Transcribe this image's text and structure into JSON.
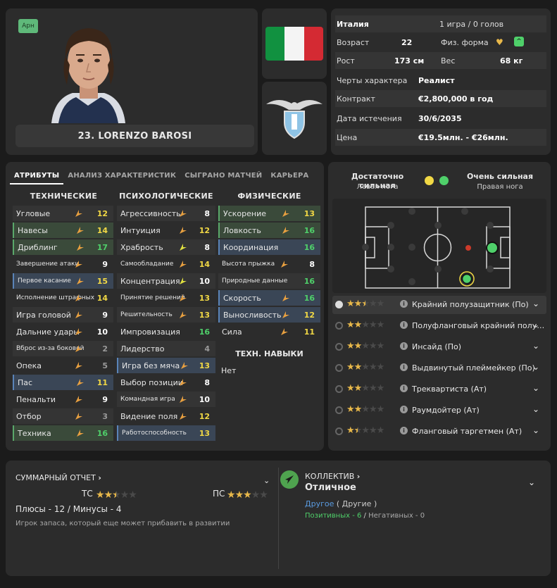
{
  "player": {
    "badge": "Арн",
    "name": "23. LORENZO BAROSI"
  },
  "info": {
    "nation": "Италия",
    "caps": "1 игра / 0 голов",
    "age_label": "Возраст",
    "age": "22",
    "fitness_label": "Физ. форма",
    "height_label": "Рост",
    "height": "173 см",
    "weight_label": "Вес",
    "weight": "68 кг",
    "traits_label": "Черты характера",
    "traits": "Реалист",
    "contract_label": "Контракт",
    "contract": "€2,800,000 в год",
    "expiry_label": "Дата истечения",
    "expiry": "30/6/2035",
    "price_label": "Цена",
    "price": "€19.5млн. - €26млн."
  },
  "tabs": [
    "АТРИБУТЫ",
    "АНАЛИЗ ХАРАКТЕРИСТИК",
    "СЫГРАНО МАТЧЕЙ",
    "КАРЬЕРА"
  ],
  "columns": {
    "technical": "ТЕХНИЧЕСКИЕ",
    "mental": "ПСИХОЛОГИЧЕСКИЕ",
    "physical": "ФИЗИЧЕСКИЕ",
    "skills": "ТЕХН. НАВЫКИ",
    "skills_value": "Нет"
  },
  "technical": [
    {
      "name": "Угловые",
      "value": "12",
      "hl": "dark",
      "color": "yellow",
      "arrow": "orange"
    },
    {
      "name": "Навесы",
      "value": "14",
      "hl": "green",
      "color": "yellow",
      "arrow": "orange"
    },
    {
      "name": "Дриблинг",
      "value": "17",
      "hl": "green",
      "color": "green",
      "arrow": "orange"
    },
    {
      "name": "Завершение атаки",
      "value": "9",
      "hl": "none",
      "color": "white",
      "arrow": "orange",
      "small": true
    },
    {
      "name": "Первое касание",
      "value": "15",
      "hl": "blue",
      "color": "yellow",
      "arrow": "orange",
      "small": true
    },
    {
      "name": "Исполнение штрафных",
      "value": "14",
      "hl": "none",
      "color": "yellow",
      "arrow": "orange",
      "small": true
    },
    {
      "name": "Игра головой",
      "value": "9",
      "hl": "dark",
      "color": "white",
      "arrow": "orange"
    },
    {
      "name": "Дальние удары",
      "value": "10",
      "hl": "none",
      "color": "white",
      "arrow": "orange"
    },
    {
      "name": "Вброс из-за боковой",
      "value": "2",
      "hl": "dark",
      "color": "grey",
      "arrow": "orange",
      "small": true
    },
    {
      "name": "Опека",
      "value": "5",
      "hl": "none",
      "color": "grey",
      "arrow": "orange"
    },
    {
      "name": "Пас",
      "value": "11",
      "hl": "blue",
      "color": "yellow",
      "arrow": "orange"
    },
    {
      "name": "Пенальти",
      "value": "9",
      "hl": "none",
      "color": "white",
      "arrow": "orange"
    },
    {
      "name": "Отбор",
      "value": "3",
      "hl": "dark",
      "color": "grey",
      "arrow": "orange"
    },
    {
      "name": "Техника",
      "value": "16",
      "hl": "green",
      "color": "green",
      "arrow": "orange"
    }
  ],
  "mental": [
    {
      "name": "Агрессивность",
      "value": "8",
      "hl": "dark",
      "color": "white",
      "arrow": "orange"
    },
    {
      "name": "Интуиция",
      "value": "12",
      "hl": "none",
      "color": "yellow",
      "arrow": "orange"
    },
    {
      "name": "Храбрость",
      "value": "8",
      "hl": "dark",
      "color": "white",
      "arrow": "yellow"
    },
    {
      "name": "Самообладание",
      "value": "14",
      "hl": "none",
      "color": "yellow",
      "arrow": "orange",
      "small": true
    },
    {
      "name": "Концентрация",
      "value": "10",
      "hl": "dark",
      "color": "white",
      "arrow": "yellow"
    },
    {
      "name": "Принятие решений",
      "value": "13",
      "hl": "none",
      "color": "yellow",
      "arrow": "orange",
      "small": true
    },
    {
      "name": "Решительность",
      "value": "13",
      "hl": "dark",
      "color": "yellow",
      "arrow": "orange",
      "small": true
    },
    {
      "name": "Импровизация",
      "value": "16",
      "hl": "none",
      "color": "green",
      "arrow": "none"
    },
    {
      "name": "Лидерство",
      "value": "4",
      "hl": "dark",
      "color": "grey",
      "arrow": "none"
    },
    {
      "name": "Игра без мяча",
      "value": "13",
      "hl": "blue",
      "color": "yellow",
      "arrow": "orange"
    },
    {
      "name": "Выбор позиции",
      "value": "8",
      "hl": "none",
      "color": "white",
      "arrow": "orange"
    },
    {
      "name": "Командная игра",
      "value": "10",
      "hl": "dark",
      "color": "white",
      "arrow": "orange",
      "small": true
    },
    {
      "name": "Видение поля",
      "value": "12",
      "hl": "none",
      "color": "yellow",
      "arrow": "orange"
    },
    {
      "name": "Работоспособность",
      "value": "13",
      "hl": "blue",
      "color": "yellow",
      "arrow": "none",
      "small": true
    }
  ],
  "physical": [
    {
      "name": "Ускорение",
      "value": "13",
      "hl": "green",
      "color": "yellow",
      "arrow": "orange"
    },
    {
      "name": "Ловкость",
      "value": "16",
      "hl": "green",
      "color": "green",
      "arrow": "orange"
    },
    {
      "name": "Координация",
      "value": "16",
      "hl": "blue",
      "color": "green",
      "arrow": "none"
    },
    {
      "name": "Высота прыжка",
      "value": "8",
      "hl": "none",
      "color": "white",
      "arrow": "orange",
      "small": true
    },
    {
      "name": "Природные данные",
      "value": "16",
      "hl": "dark",
      "color": "green",
      "arrow": "none",
      "small": true
    },
    {
      "name": "Скорость",
      "value": "16",
      "hl": "blue",
      "color": "green",
      "arrow": "orange"
    },
    {
      "name": "Выносливость",
      "value": "12",
      "hl": "blue",
      "color": "yellow",
      "arrow": "orange"
    },
    {
      "name": "Сила",
      "value": "11",
      "hl": "none",
      "color": "yellow",
      "arrow": "orange"
    }
  ],
  "feet": {
    "left_rating": "Достаточно сильная",
    "left_label": "Левая нога",
    "right_rating": "Очень сильная",
    "right_label": "Правая нога"
  },
  "roles": [
    {
      "label": "Крайний полузащитник (По)",
      "stars": 2.5,
      "selected": true
    },
    {
      "label": "Полуфланговый крайний полу…",
      "stars": 2,
      "selected": false
    },
    {
      "label": "Инсайд (По)",
      "stars": 2,
      "selected": false
    },
    {
      "label": "Выдвинутый плеймейкер (По)",
      "stars": 2,
      "selected": false
    },
    {
      "label": "Треквартиста (Ат)",
      "stars": 2,
      "selected": false
    },
    {
      "label": "Раумдойтер (Ат)",
      "stars": 2,
      "selected": false
    },
    {
      "label": "Фланговый таргетмен (Ат)",
      "stars": 1.5,
      "selected": false
    }
  ],
  "summary": {
    "title": "СУММАРНЫЙ ОТЧЕТ",
    "tc_label": "ТС",
    "tc_stars": 2.5,
    "pc_label": "ПС",
    "pc_stars": 3,
    "pros": "Плюсы - 12 / Минусы - 4",
    "desc": "Игрок запаса, который еще может прибавить в развитии"
  },
  "team": {
    "title": "КОЛЛЕКТИВ",
    "status": "Отличное",
    "group": "Другое",
    "group_paren": "( Другие )",
    "positive": "Позитивных - 6",
    "sep": "/",
    "negative": "Негативных - 0"
  },
  "colors": {
    "green": "#4fd06a",
    "yellow": "#f1d845",
    "accent": "#4fa34f"
  }
}
